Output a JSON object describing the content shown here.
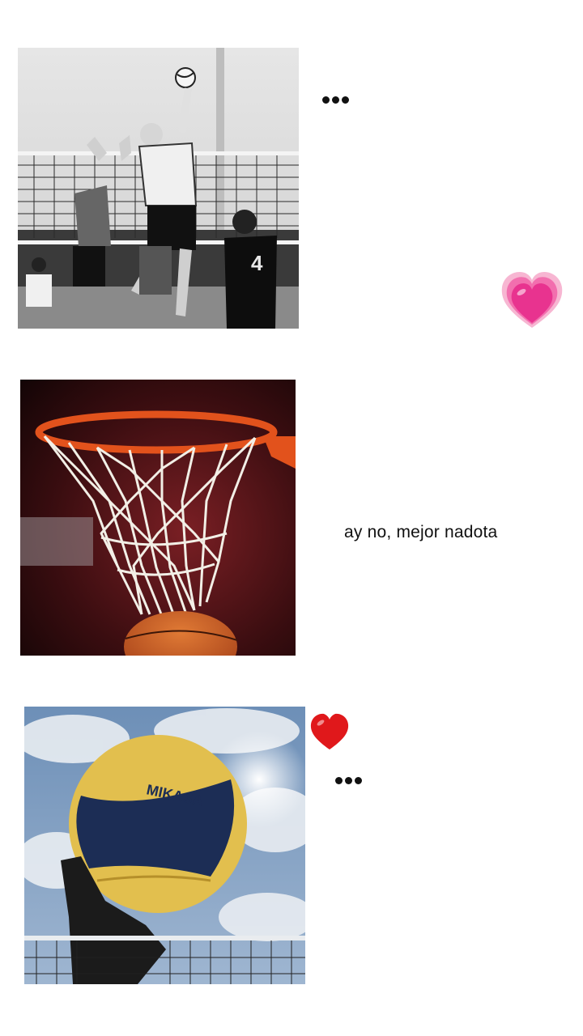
{
  "posts": [
    {
      "image": "volleyball-spike-photo",
      "reply_type": "dots",
      "reaction": "growing-heart-emoji"
    },
    {
      "image": "basketball-hoop-photo",
      "reply_type": "text",
      "reply_text": "ay no, mejor nadota"
    },
    {
      "image": "volleyball-sky-photo",
      "reply_type": "dots",
      "reaction": "red-heart-emoji"
    }
  ],
  "colors": {
    "background": "#ffffff",
    "text": "#111111",
    "heart_pink": "#e8338f",
    "heart_red": "#e0181b",
    "rim_orange": "#e2521c"
  }
}
